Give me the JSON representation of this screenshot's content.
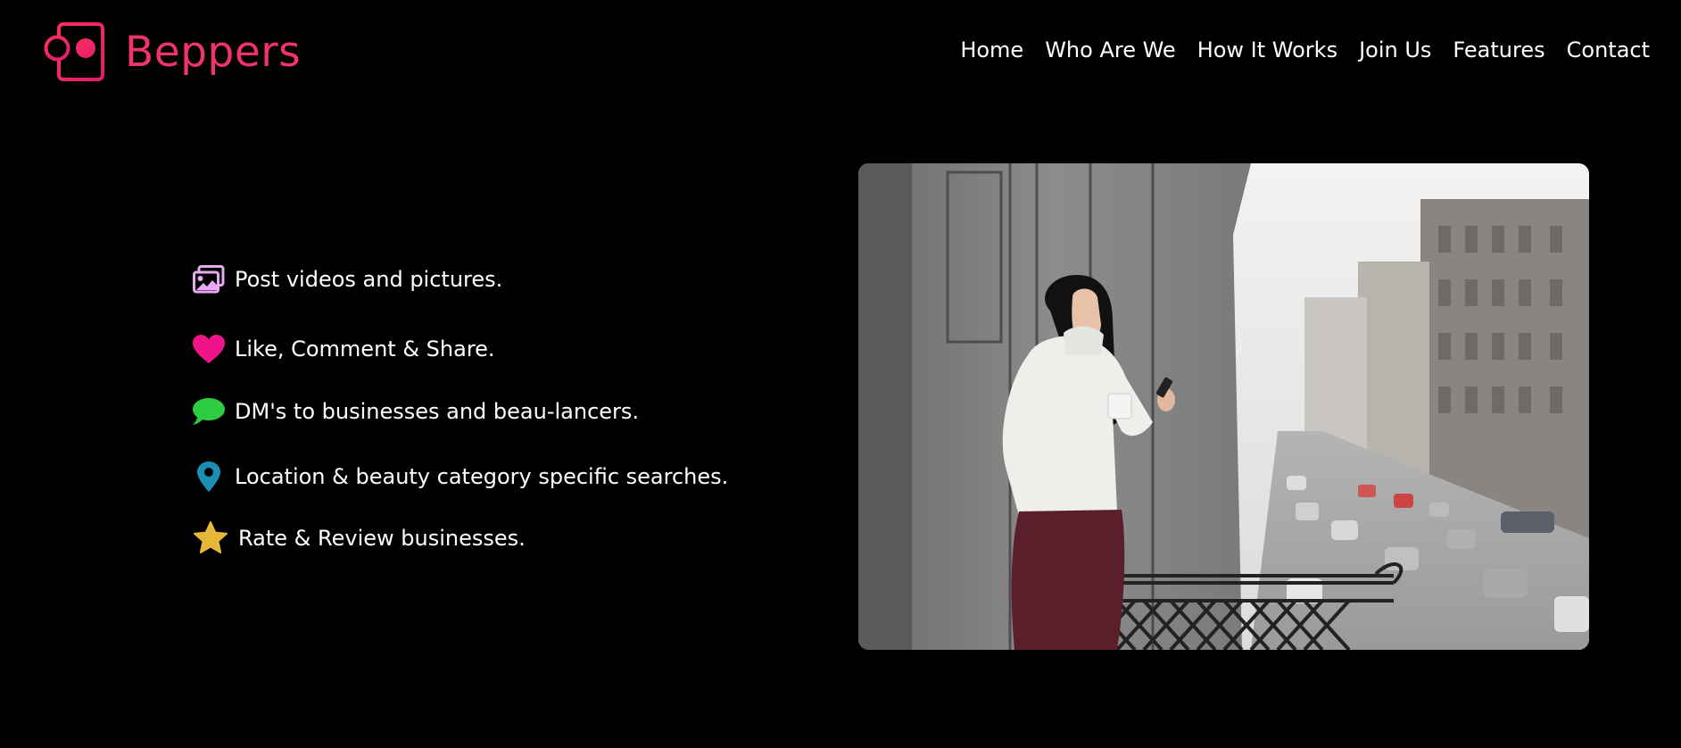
{
  "brand": {
    "name": "Beppers",
    "color": "#f0336b"
  },
  "nav": {
    "items": [
      {
        "label": "Home"
      },
      {
        "label": "Who Are We"
      },
      {
        "label": "How It Works"
      },
      {
        "label": "Join Us"
      },
      {
        "label": "Features"
      },
      {
        "label": "Contact"
      }
    ]
  },
  "features": [
    {
      "icon": "pictures-icon",
      "icon_color": "#e9a8f2",
      "text": "Post videos and pictures."
    },
    {
      "icon": "heart-icon",
      "icon_color": "#f0148a",
      "text": "Like, Comment & Share."
    },
    {
      "icon": "chat-bubble-icon",
      "icon_color": "#2ecc40",
      "text": "DM's to businesses and beau-lancers."
    },
    {
      "icon": "map-pin-icon",
      "icon_color": "#1b8fb3",
      "text": "Location & beauty category specific searches."
    },
    {
      "icon": "star-icon",
      "icon_color": "#e6b83a",
      "text": "Rate & Review businesses."
    }
  ],
  "hero_image": {
    "subject": "woman with coffee cup and phone on city balcony"
  }
}
